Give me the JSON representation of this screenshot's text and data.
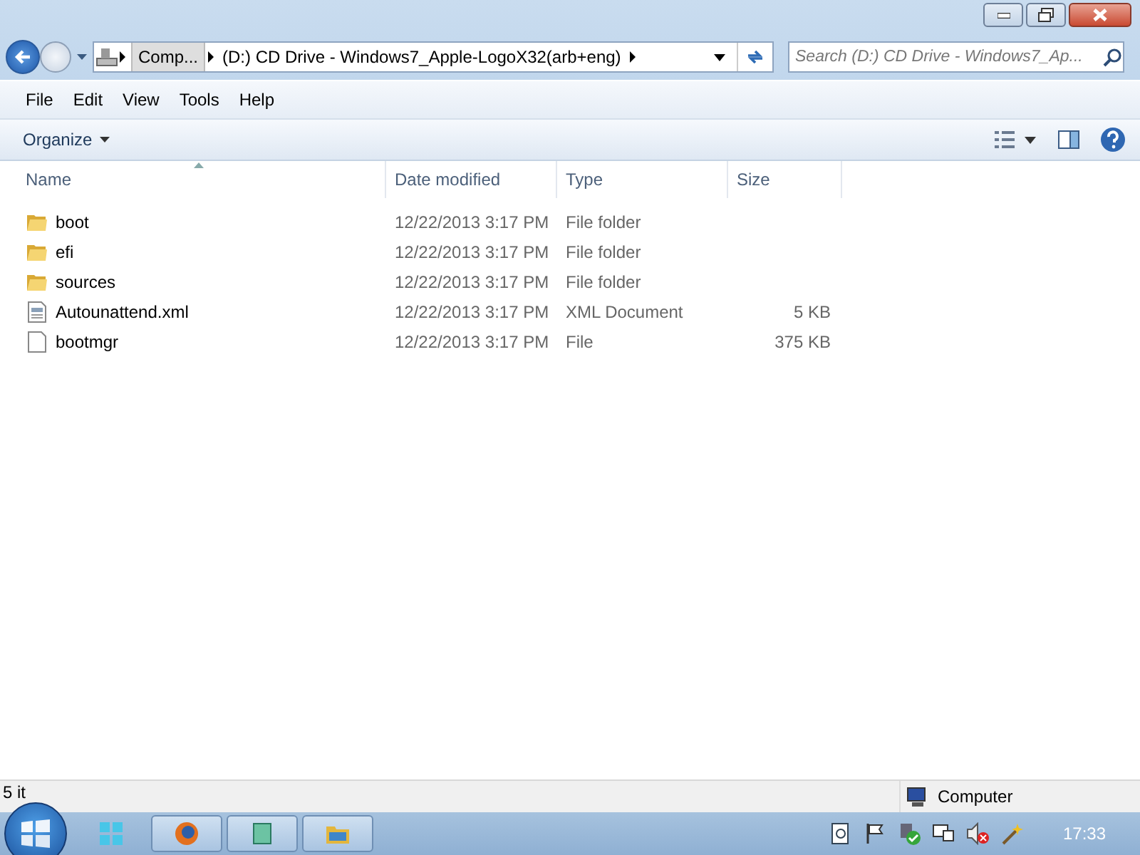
{
  "address": {
    "crumbs": [
      "Comp...",
      "(D:) CD Drive - Windows7_Apple-LogoX32(arb+eng)"
    ]
  },
  "search": {
    "placeholder": "Search (D:) CD Drive - Windows7_Ap..."
  },
  "menu": [
    "File",
    "Edit",
    "View",
    "Tools",
    "Help"
  ],
  "toolbar": {
    "organize": "Organize"
  },
  "table": {
    "columns": [
      "Name",
      "Date modified",
      "Type",
      "Size"
    ],
    "rows": [
      {
        "kind": "folder",
        "name": "boot",
        "date": "12/22/2013 3:17 PM",
        "type": "File folder"
      },
      {
        "kind": "folder",
        "name": "efi",
        "date": "12/22/2013 3:17 PM",
        "type": "File folder"
      },
      {
        "kind": "folder",
        "name": "sources",
        "date": "12/22/2013 3:17 PM",
        "type": "File folder"
      },
      {
        "kind": "xml",
        "name": "Autounattend.xml",
        "date": "12/22/2013 3:17 PM",
        "type": "XML Document",
        "size": "5 KB"
      },
      {
        "kind": "file",
        "name": "bootmgr",
        "date": "12/22/2013 3:17 PM",
        "type": "File",
        "size": "375 KB"
      }
    ]
  },
  "status_bar": {
    "count": "5 it",
    "location": "Computer"
  },
  "taskbar": {
    "clock": "17:33"
  }
}
